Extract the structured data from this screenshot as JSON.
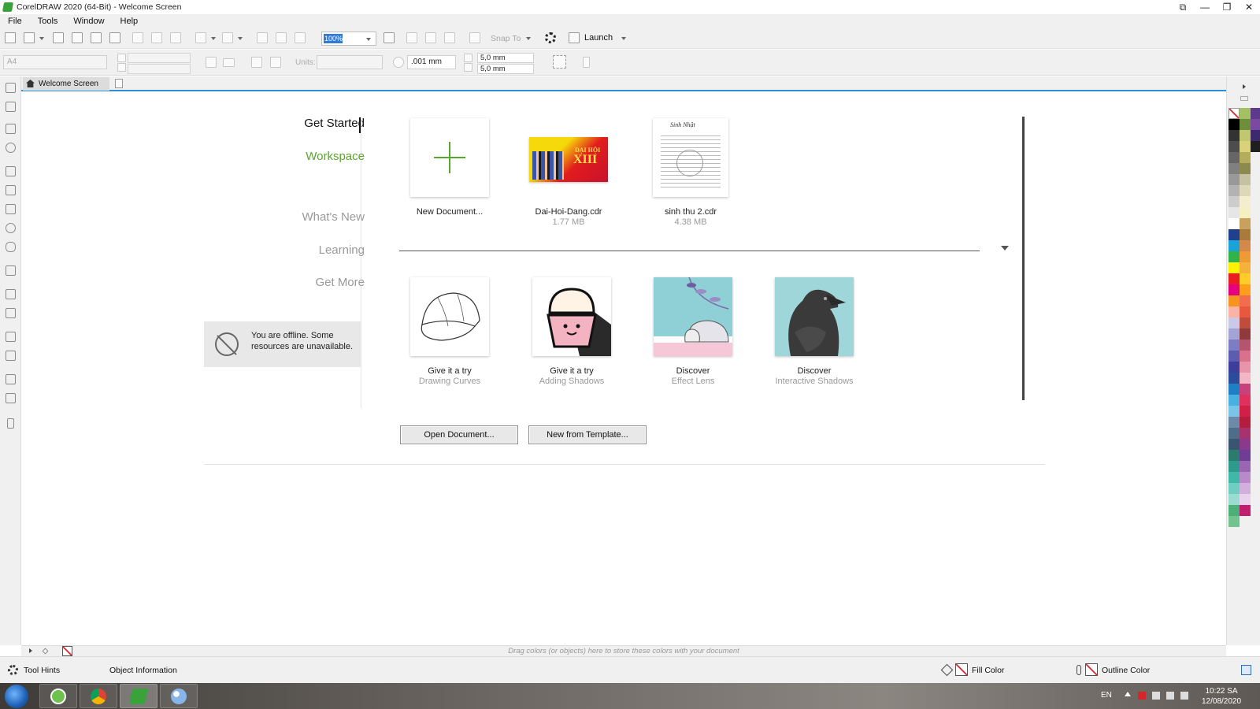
{
  "window": {
    "title": "CorelDRAW 2020 (64-Bit) - Welcome Screen",
    "controls": [
      "⧉",
      "—",
      "❐",
      "✕"
    ]
  },
  "menu": [
    "File",
    "Tools",
    "Window",
    "Help"
  ],
  "toolbar": {
    "zoom_value": "100%",
    "snap_to": "Snap To",
    "launch": "Launch"
  },
  "property_bar": {
    "page_size": "A4",
    "units_label": "Units:",
    "nudge": ".001 mm",
    "duplicate_x": "5,0 mm",
    "duplicate_y": "5,0 mm"
  },
  "tab": {
    "label": "Welcome Screen"
  },
  "nav": {
    "get_started": "Get Started",
    "workspace": "Workspace",
    "whats_new": "What's New",
    "learning": "Learning",
    "get_more": "Get More",
    "accent_color": "#5aa52e"
  },
  "offline": {
    "message": "You are offline. Some resources are unavailable."
  },
  "recent": [
    {
      "label": "New Document...",
      "size": ""
    },
    {
      "label": "Dai-Hoi-Dang.cdr",
      "size": "1.77 MB"
    },
    {
      "label": "sinh thu 2.cdr",
      "size": "4.38 MB"
    }
  ],
  "learn_cards": [
    {
      "title": "Give it a try",
      "subtitle": "Drawing Curves"
    },
    {
      "title": "Give it a try",
      "subtitle": "Adding Shadows"
    },
    {
      "title": "Discover",
      "subtitle": "Effect Lens"
    },
    {
      "title": "Discover",
      "subtitle": "Interactive Shadows"
    }
  ],
  "thumb_text": {
    "dai_hoi": "ĐẠI HỘI",
    "xiii": "XIII",
    "sinh_nhat": "Sinh Nhật"
  },
  "buttons": {
    "open_document": "Open Document...",
    "new_from_template": "New from Template..."
  },
  "color_tray": {
    "hint": "Drag colors (or objects) here to store these colors with your document"
  },
  "status": {
    "tool_hints": "Tool Hints",
    "object_information": "Object Information",
    "fill_color": "Fill Color",
    "outline_color": "Outline Color"
  },
  "taskbar": {
    "language": "EN",
    "time": "10:22 SA",
    "date": "12/08/2020"
  },
  "palette": {
    "col1": [
      "#000000",
      "#333333",
      "#4d4d4d",
      "#666666",
      "#808080",
      "#999999",
      "#b3b3b3",
      "#cccccc",
      "#e6e6e6",
      "#ffffff",
      "#1f3f8f",
      "#1aa3d9",
      "#2fb34a",
      "#fff200",
      "#ed1c24",
      "#e4007f",
      "#f7941d",
      "#fbb3a5",
      "#c9c9e8",
      "#a3a3d6",
      "#7d7dc4",
      "#5c5cb0",
      "#3d3d9c",
      "#2b4c9b",
      "#1f7fc4",
      "#49b0e2",
      "#79c5e8",
      "#6c8ba8",
      "#4f6d89",
      "#3a566f",
      "#2b7c6f",
      "#2d9b8c",
      "#3fb8a8",
      "#6ccfc1",
      "#9adcd2",
      "#4caf7a",
      "#72c48f"
    ],
    "col2": [
      "#a3c163",
      "#6e8f3a",
      "#c0c76e",
      "#d9d27a",
      "#b3ad5c",
      "#8c8a4f",
      "#c5c1a3",
      "#ddd9b8",
      "#f2eecf",
      "#f5f0c0",
      "#c7a15d",
      "#a87b3c",
      "#d4884a",
      "#f09a36",
      "#f5b23a",
      "#ffcc29",
      "#ff9e1b",
      "#f26c4f",
      "#e9573f",
      "#c14b3c",
      "#8f3b3b",
      "#b5546d",
      "#d9708c",
      "#e895aa",
      "#f2b6c4",
      "#c7417a",
      "#e0315e",
      "#d11f45",
      "#b51c3e",
      "#a8326e",
      "#8a3a8c",
      "#6f3d95",
      "#9a66b3",
      "#b88ac9",
      "#d1b0dd",
      "#e8d2ec",
      "#c21d6e"
    ],
    "col3": [
      "#5e3a8c",
      "#7a4aa3",
      "#3d2a6e",
      "#1f1f1f"
    ]
  }
}
